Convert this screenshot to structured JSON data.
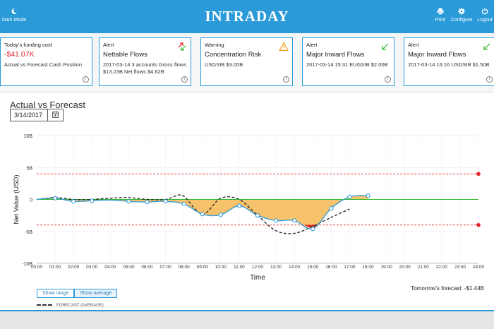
{
  "header": {
    "brand": "INTRADAY",
    "dark_mode": "Dark Mode",
    "print": "Print",
    "configure": "Configure",
    "logout": "Logout"
  },
  "cards": [
    {
      "type": "Today's funding cost",
      "big": "-$41.07K",
      "body": "Actual vs Forecast Cash Position",
      "icon": "none"
    },
    {
      "type": "Alert",
      "title": "Nettable Flows",
      "body": "2017-03-14 3 accounts Gross flows $13.23B Net flows $4.62B",
      "icon": "up-down-arrows-icon"
    },
    {
      "type": "Warning",
      "title": "Concentration Risk",
      "body": "USGSIB $3.00B",
      "icon": "warning-triangle-icon"
    },
    {
      "type": "Alert",
      "title": "Major Inward Flows",
      "body": "2017-03-14 15:31 EUGSIB $2.00B",
      "icon": "down-left-arrow-icon"
    },
    {
      "type": "Alert",
      "title": "Major Inward Flows",
      "body": "2017-03-14 16:16 USGSIB $1.50B",
      "icon": "down-left-arrow-icon"
    }
  ],
  "section_title": "Actual vs Forecast",
  "date_value": "3/14/2017",
  "buttons": {
    "show_range": "Show range",
    "show_average": "Show average"
  },
  "tomorrow": "Tomorrow's forecast: -$1.44B",
  "legend_label": "FORECAST (AVERAGE)",
  "colors": {
    "accent": "#2a9ad8",
    "actual_line": "#2a9ad8",
    "fill": "#f5b752",
    "threshold": "#e0242a",
    "zero_line": "#2ebd2e",
    "forecast": "#222222"
  },
  "chart_data": {
    "type": "line",
    "xlabel": "Time",
    "ylabel": "Net Value (USD)",
    "x_ticks": [
      "00:00",
      "01:00",
      "02:00",
      "03:00",
      "04:00",
      "05:00",
      "06:00",
      "07:00",
      "08:00",
      "09:00",
      "10:00",
      "11:00",
      "12:00",
      "13:00",
      "14:00",
      "15:00",
      "16:00",
      "17:00",
      "18:00",
      "19:00",
      "20:00",
      "21:00",
      "22:00",
      "23:00",
      "24:00"
    ],
    "y_ticks": [
      {
        "v": 10,
        "label": "10B"
      },
      {
        "v": 5,
        "label": "5B"
      },
      {
        "v": 0,
        "label": "0"
      },
      {
        "v": -5,
        "label": "-5B"
      },
      {
        "v": -10,
        "label": "-10B"
      }
    ],
    "ylim": [
      -10,
      10
    ],
    "xlim": [
      0,
      24
    ],
    "thresholds": [
      4,
      -4
    ],
    "actual": [
      [
        0,
        0
      ],
      [
        1,
        0.2
      ],
      [
        2,
        -0.3
      ],
      [
        3,
        -0.2
      ],
      [
        4,
        -0.1
      ],
      [
        5,
        -0.3
      ],
      [
        6,
        -0.4
      ],
      [
        7,
        -0.3
      ],
      [
        8,
        -0.7
      ],
      [
        9,
        -2.3
      ],
      [
        10,
        -2.4
      ],
      [
        11,
        -1.0
      ],
      [
        12,
        -2.5
      ],
      [
        13,
        -3.3
      ],
      [
        14,
        -3.3
      ],
      [
        15,
        -4.6
      ],
      [
        16,
        -1.4
      ],
      [
        17,
        0.4
      ],
      [
        18,
        0.6
      ]
    ],
    "actual_markers": [
      1,
      2,
      3,
      5,
      6,
      7,
      8,
      9,
      10,
      11,
      12,
      13,
      14,
      15,
      16,
      17,
      18
    ],
    "forecast": [
      [
        0,
        0
      ],
      [
        1,
        0.3
      ],
      [
        2,
        0
      ],
      [
        3,
        0
      ],
      [
        4,
        0.2
      ],
      [
        5,
        0.3
      ],
      [
        6,
        0
      ],
      [
        7,
        0
      ],
      [
        7.5,
        0.5
      ],
      [
        8,
        0.5
      ],
      [
        9,
        -2.3
      ],
      [
        10,
        0.2
      ],
      [
        11,
        0
      ],
      [
        12,
        -2.5
      ],
      [
        13,
        -4.9
      ],
      [
        14,
        -5.3
      ],
      [
        15,
        -4.2
      ],
      [
        16,
        -2.8
      ],
      [
        17,
        -1.5
      ]
    ],
    "alert_dots": [
      [
        24,
        4
      ],
      [
        24,
        -4
      ]
    ]
  }
}
